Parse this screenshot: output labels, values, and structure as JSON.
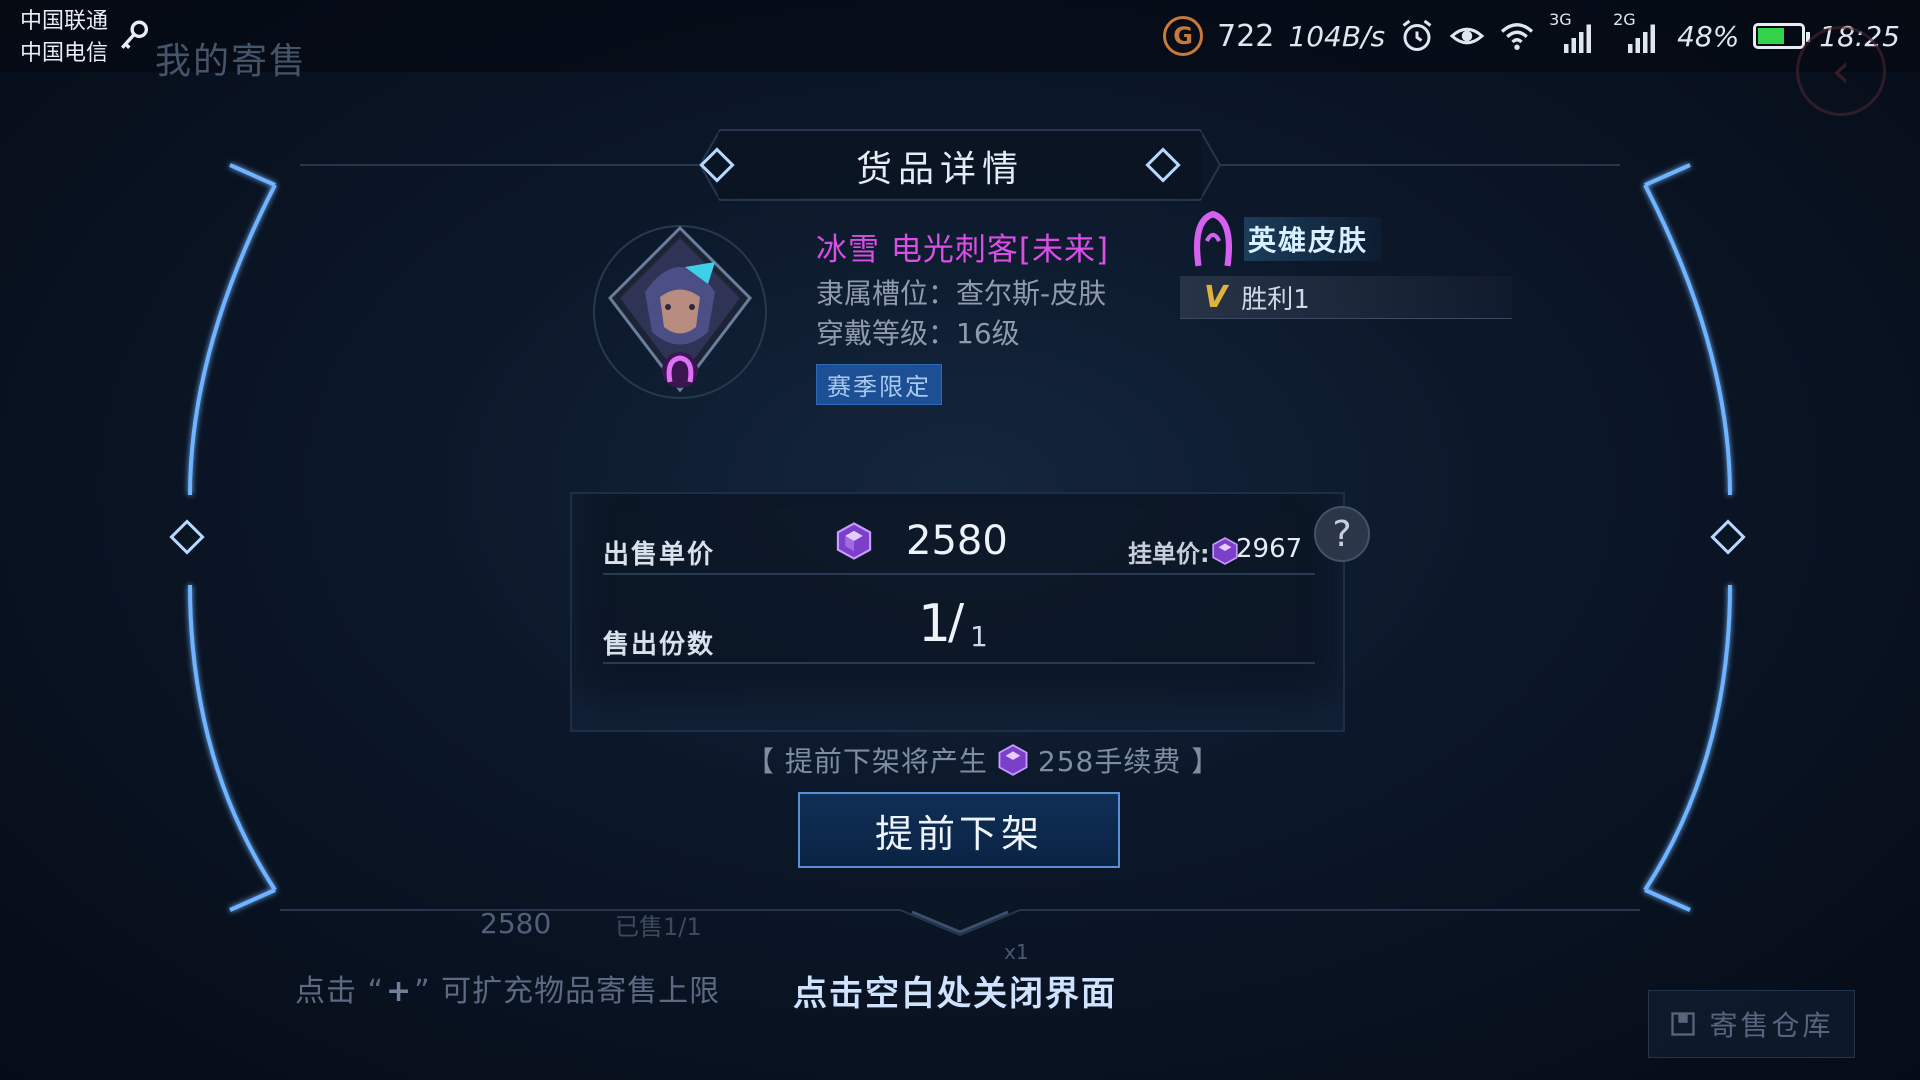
{
  "status_bar": {
    "carrier_1": "中国联通",
    "carrier_2": "中国电信",
    "g_badge": "G",
    "data_count": "722",
    "net_speed": "104B/s",
    "network_3g": "3G",
    "network_2g": "2G",
    "battery_percent": "48%",
    "time": "18:25",
    "icons": [
      "key-icon",
      "alarm-icon",
      "eye-icon",
      "wifi-icon",
      "signal-icon",
      "signal-icon",
      "battery-icon"
    ]
  },
  "background": {
    "page_title": "我的寄售",
    "hint_prefix": "点击 “",
    "hint_plus": "+",
    "hint_suffix": "” 可扩充物品寄售上限",
    "row_price": "2580",
    "row_sold": "已售1/1",
    "row_qty": "x1",
    "warehouse_button": "寄售仓库"
  },
  "dialog": {
    "title": "货品详情",
    "item": {
      "name": "冰雪 电光刺客[未来]",
      "slot": "隶属槽位：查尔斯-皮肤",
      "level": "穿戴等级：16级",
      "season_tag": "赛季限定",
      "type_label": "英雄皮肤",
      "win_icon": "V",
      "win_label": "胜利1"
    },
    "price_label": "出售单价",
    "price_value": "2580",
    "list_price_label": "挂单价:",
    "list_price_value": "2967",
    "help": "?",
    "quantity_label": "售出份数",
    "quantity_current": "1",
    "quantity_total": "1",
    "fee_open": "【 提前下架将产生",
    "fee_value": "258手续费 】",
    "withdraw_button": "提前下架",
    "close_hint": "点击空白处关闭界面"
  },
  "colors": {
    "item_name": "#d94fe6",
    "season_tag_bg": "#1c4f93",
    "win_icon": "#e1b23a",
    "button_border": "#5b8fd3",
    "frame_glow": "#6fb4ff"
  }
}
